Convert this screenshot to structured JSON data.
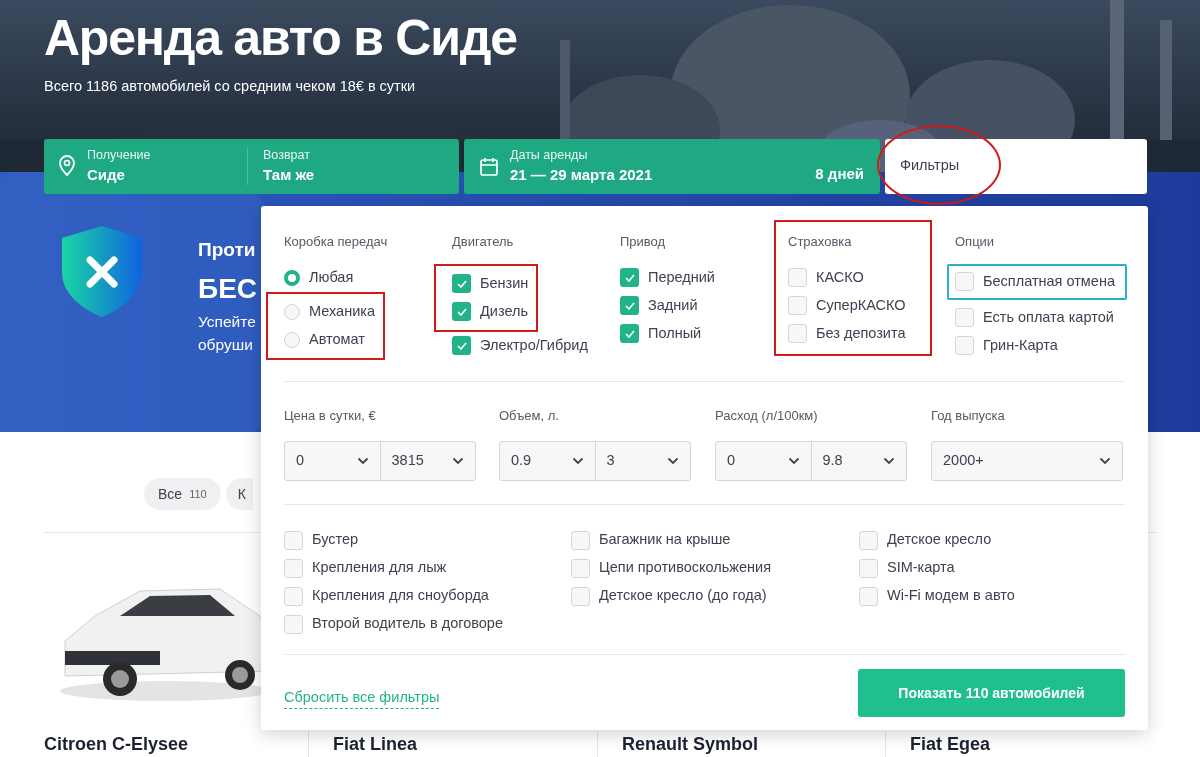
{
  "hero": {
    "title": "Аренда авто в Сиде",
    "subtitle": "Всего 1186 автомобилей со средним чеком 18€ в сутки"
  },
  "search": {
    "pickup": {
      "label": "Получение",
      "value": "Сиде"
    },
    "return": {
      "label": "Возврат",
      "value": "Там же"
    },
    "dates": {
      "label": "Даты аренды",
      "value": "21 — 29 марта 2021",
      "duration": "8 дней"
    },
    "filters": {
      "label": "Фильтры",
      "annotated": true
    }
  },
  "promo": {
    "title": "Проти",
    "subtitle": "БЕС",
    "lines": [
      "Успейте",
      "обруши"
    ]
  },
  "category_tabs": [
    {
      "label": "Все",
      "count": "110"
    },
    {
      "label": "К",
      "clipped": true
    }
  ],
  "cars": [
    {
      "name": "Citroen C-Elysee"
    },
    {
      "name": "Fiat Linea"
    },
    {
      "name": "Renault Symbol"
    },
    {
      "name": "Fiat Egea"
    }
  ],
  "filter_panel": {
    "groups": [
      {
        "title": "Коробка передач",
        "kind": "radio",
        "options": [
          {
            "label": "Любая",
            "selected": true
          },
          {
            "label": "Механика",
            "selected": false,
            "annotated": true
          },
          {
            "label": "Автомат",
            "selected": false,
            "annotated": true
          }
        ]
      },
      {
        "title": "Двигатель",
        "kind": "checkbox",
        "options": [
          {
            "label": "Бензин",
            "checked": true,
            "annotated": true
          },
          {
            "label": "Дизель",
            "checked": true,
            "annotated": true
          },
          {
            "label": "Электро/Гибрид",
            "checked": true
          }
        ]
      },
      {
        "title": "Привод",
        "kind": "checkbox",
        "options": [
          {
            "label": "Передний",
            "checked": true
          },
          {
            "label": "Задний",
            "checked": true
          },
          {
            "label": "Полный",
            "checked": true
          }
        ]
      },
      {
        "title": "Страховка",
        "kind": "checkbox",
        "annotated": true,
        "options": [
          {
            "label": "КАСКО",
            "checked": false
          },
          {
            "label": "СуперКАСКО",
            "checked": false
          },
          {
            "label": "Без депозита",
            "checked": false
          }
        ]
      },
      {
        "title": "Опции",
        "kind": "checkbox",
        "options": [
          {
            "label": "Бесплатная отмена",
            "checked": false,
            "highlighted": true
          },
          {
            "label": "Есть оплата картой",
            "checked": false
          },
          {
            "label": "Грин-Карта",
            "checked": false
          }
        ]
      }
    ],
    "ranges": [
      {
        "label": "Цена в сутки, €",
        "fields": [
          "0",
          "3815"
        ]
      },
      {
        "label": "Объем, л.",
        "fields": [
          "0.9",
          "3"
        ]
      },
      {
        "label": "Расход (л/100км)",
        "fields": [
          "0",
          "9.8"
        ]
      },
      {
        "label": "Год выпуска",
        "fields": [
          "2000+"
        ]
      }
    ],
    "extras": [
      [
        {
          "label": "Бустер",
          "checked": false
        },
        {
          "label": "Крепления для лыж",
          "checked": false
        },
        {
          "label": "Крепления для сноуборда",
          "checked": false
        },
        {
          "label": "Второй водитель в договоре",
          "checked": false
        }
      ],
      [
        {
          "label": "Багажник на крыше",
          "checked": false
        },
        {
          "label": "Цепи противоскольжения",
          "checked": false
        },
        {
          "label": "Детское кресло (до года)",
          "checked": false
        }
      ],
      [
        {
          "label": "Детское кресло",
          "checked": false
        },
        {
          "label": "SIM-карта",
          "checked": false
        },
        {
          "label": "Wi-Fi модем в авто",
          "checked": false
        }
      ]
    ],
    "reset_link": "Сбросить все фильтры",
    "show_button": "Показать 110 автомобилей"
  }
}
